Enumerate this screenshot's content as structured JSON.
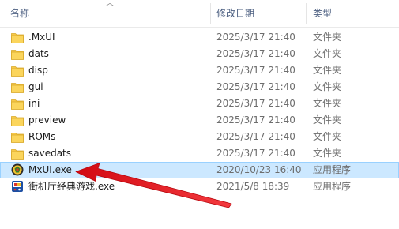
{
  "columns": {
    "name": "名称",
    "date": "修改日期",
    "type": "类型"
  },
  "rows": [
    {
      "name": ".MxUI",
      "date": "2025/3/17 21:40",
      "type": "文件夹",
      "icon": "folder-icon"
    },
    {
      "name": "dats",
      "date": "2025/3/17 21:40",
      "type": "文件夹",
      "icon": "folder-icon"
    },
    {
      "name": "disp",
      "date": "2025/3/17 21:40",
      "type": "文件夹",
      "icon": "folder-icon"
    },
    {
      "name": "gui",
      "date": "2025/3/17 21:40",
      "type": "文件夹",
      "icon": "folder-icon"
    },
    {
      "name": "ini",
      "date": "2025/3/17 21:40",
      "type": "文件夹",
      "icon": "folder-icon"
    },
    {
      "name": "preview",
      "date": "2025/3/17 21:40",
      "type": "文件夹",
      "icon": "folder-icon"
    },
    {
      "name": "ROMs",
      "date": "2025/3/17 21:40",
      "type": "文件夹",
      "icon": "folder-icon"
    },
    {
      "name": "savedats",
      "date": "2025/3/17 21:40",
      "type": "文件夹",
      "icon": "folder-icon"
    },
    {
      "name": "MxUI.exe",
      "date": "2020/10/23 16:40",
      "type": "应用程序",
      "icon": "mxui-app-icon",
      "selected": true
    },
    {
      "name": "街机厅经典游戏.exe",
      "date": "2021/5/8 18:39",
      "type": "应用程序",
      "icon": "arcade-app-icon"
    }
  ],
  "colors": {
    "selection": "#cce8ff",
    "folder": "#f7c948",
    "arrow": "#e8141c",
    "header_text": "#4d6082"
  }
}
